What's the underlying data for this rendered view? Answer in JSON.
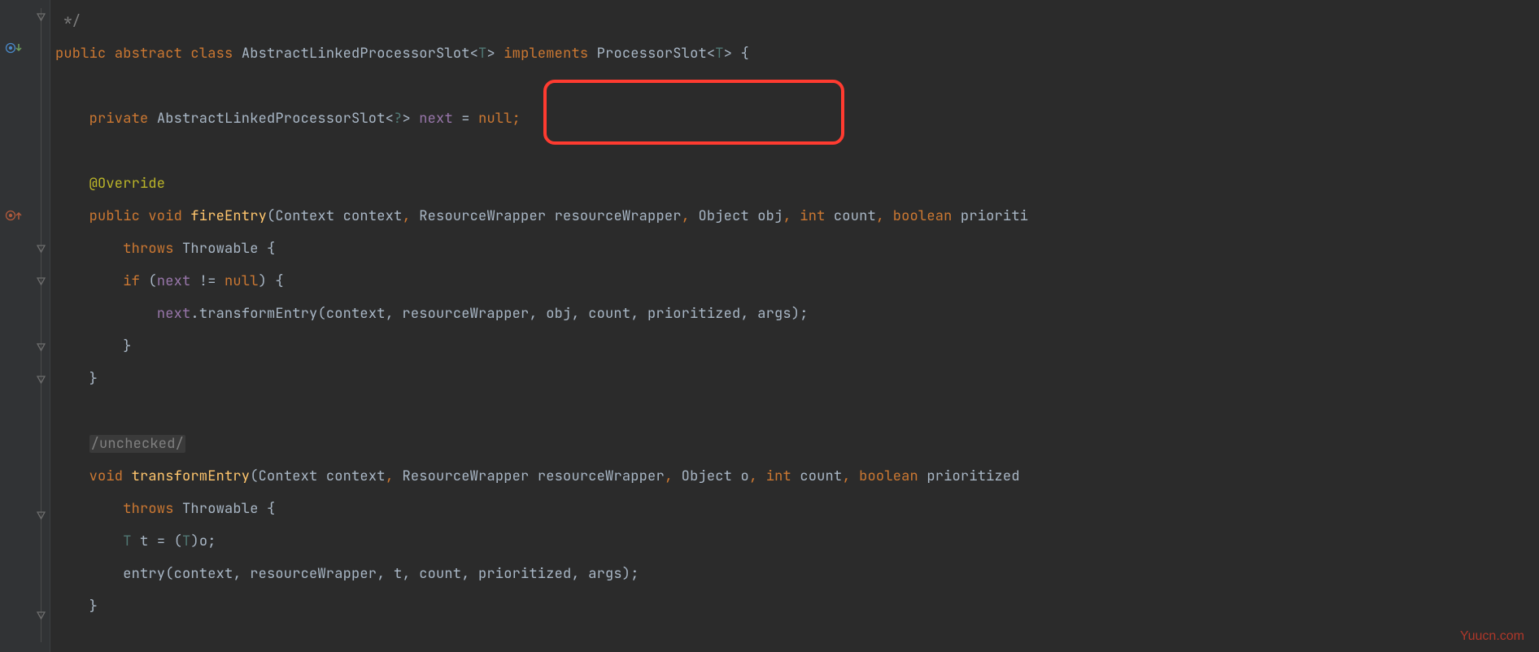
{
  "code": {
    "l1": " */",
    "l2_kw1": "public ",
    "l2_kw2": "abstract ",
    "l2_kw3": "class ",
    "l2_t1": "AbstractLinkedProcessorSlot",
    "l2_g1": "<",
    "l2_g2": "T",
    "l2_g3": "> ",
    "l2_kw4": "implements ",
    "l2_t2": "ProcessorSlot",
    "l2_g4": "<",
    "l2_g5": "T",
    "l2_g6": ">",
    "l2_p1": " {",
    "l3": "",
    "l4_kw1": "    private ",
    "l4_t1": "AbstractLinkedProcessorSlot",
    "l4_g1": "<",
    "l4_g2": "?",
    "l4_g3": "> ",
    "l4_f1": "next ",
    "l4_p1": "= ",
    "l4_n1": "null",
    "l4_p2": ";",
    "l5": "",
    "l6": "    @Override",
    "l7_kw1": "    public ",
    "l7_kw2": "void ",
    "l7_m1": "fireEntry",
    "l7_p1": "(",
    "l7_t1": "Context ",
    "l7_v1": "context",
    "l7_c1": ", ",
    "l7_t2": "ResourceWrapper ",
    "l7_v2": "resourceWrapper",
    "l7_c2": ", ",
    "l7_t3": "Object ",
    "l7_v3": "obj",
    "l7_c3": ", ",
    "l7_kw3": "int ",
    "l7_v4": "count",
    "l7_c4": ", ",
    "l7_kw4": "boolean ",
    "l7_v5": "prioriti",
    "l8_kw1": "        throws ",
    "l8_t1": "Throwable ",
    "l8_p1": "{",
    "l9_kw1": "        if ",
    "l9_p1": "(",
    "l9_f1": "next ",
    "l9_p2": "!= ",
    "l9_n1": "null",
    "l9_p3": ") {",
    "l10_p0": "            ",
    "l10_f1": "next",
    "l10_p1": ".",
    "l10_m1": "transformEntry",
    "l10_p2": "(context, resourceWrapper, obj, count, prioritized, args);",
    "l11": "        }",
    "l12": "    }",
    "l13": "",
    "l14": "    /unchecked/",
    "l15_kw1": "    void ",
    "l15_m1": "transformEntry",
    "l15_p1": "(",
    "l15_t1": "Context ",
    "l15_v1": "context",
    "l15_c1": ", ",
    "l15_t2": "ResourceWrapper ",
    "l15_v2": "resourceWrapper",
    "l15_c2": ", ",
    "l15_t3": "Object ",
    "l15_v3": "o",
    "l15_c3": ", ",
    "l15_kw2": "int ",
    "l15_v4": "count",
    "l15_c4": ", ",
    "l15_kw3": "boolean ",
    "l15_v5": "prioritized",
    "l16_kw1": "        throws ",
    "l16_t1": "Throwable ",
    "l16_p1": "{",
    "l17_p0": "        ",
    "l17_t1": "T ",
    "l17_v1": "t ",
    "l17_p1": "= (",
    "l17_t2": "T",
    "l17_p2": ")o;",
    "l18": "        entry(context, resourceWrapper, t, count, prioritized, args);",
    "l19": "    }"
  },
  "watermark": "Yuucn.com"
}
